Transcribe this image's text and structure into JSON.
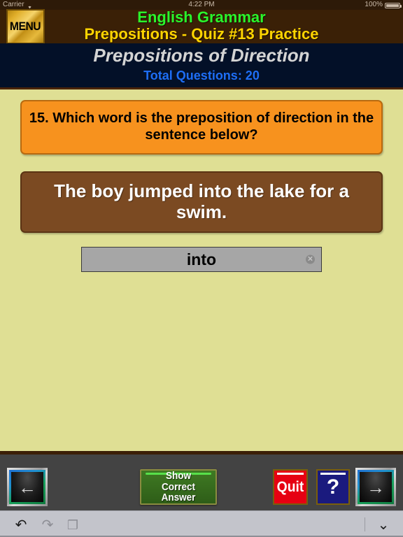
{
  "status_bar": {
    "carrier": "Carrier",
    "wifi_icon": "wifi-icon",
    "time": "4:22 PM",
    "battery_percent": "100%",
    "battery_icon": "battery-full-icon"
  },
  "header": {
    "menu_label": "MENU",
    "app_title": "English Grammar",
    "quiz_title": "Prepositions - Quiz #13 Practice",
    "subtitle": "Prepositions of Direction",
    "total_questions": "Total Questions: 20",
    "colors": {
      "brown_bar": "#3a2006",
      "navy_bar": "#031028",
      "app_title_color": "#2bf52b",
      "quiz_title_color": "#ffd400",
      "subtitle_color": "#d4d4d4",
      "total_color": "#1e6ef5"
    }
  },
  "main": {
    "background": "#dfdf94",
    "question": {
      "number": "15.",
      "text": "15. Which word is the preposition of direction in the sentence below?",
      "bg": "#f7921e",
      "text_color": "#000000"
    },
    "sentence": {
      "text": "The boy jumped into the lake for a swim.",
      "bg": "#7b4a22",
      "text_color": "#ffffff"
    },
    "answer_input": {
      "value": "into",
      "placeholder": "",
      "clear_icon": "clear-circle-icon",
      "bg": "#a6a6a6"
    }
  },
  "toolbar": {
    "background": "#434343",
    "prev_label": "←",
    "prev_icon": "arrow-left-icon",
    "next_label": "→",
    "next_icon": "arrow-right-icon",
    "show_answer_line1": "Show",
    "show_answer_line2": "Correct Answer",
    "quit_label": "Quit",
    "help_label": "?"
  },
  "keyboard_bar": {
    "undo_icon": "↶",
    "redo_icon": "↷",
    "paste_icon": "❐",
    "dismiss_icon": "⌄"
  }
}
